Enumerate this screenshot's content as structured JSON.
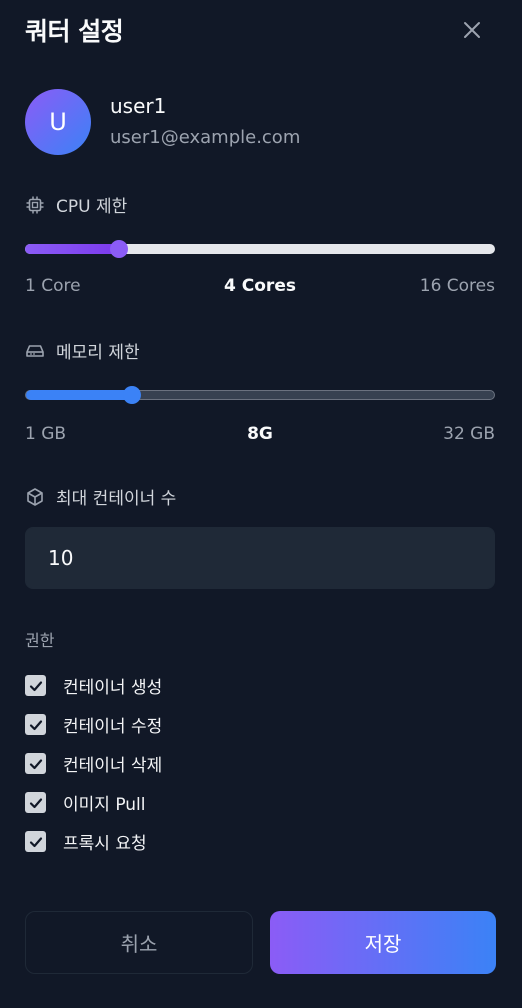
{
  "header": {
    "title": "쿼터 설정",
    "close_icon": "close-icon"
  },
  "user": {
    "avatar_initial": "U",
    "name": "user1",
    "email": "user1@example.com"
  },
  "cpu": {
    "label": "CPU 제한",
    "icon": "cpu-chip-icon",
    "min_label": "1 Core",
    "current_label": "4 Cores",
    "max_label": "16 Cores",
    "value": 4,
    "min": 1,
    "max": 16,
    "color": "#8b5cf6"
  },
  "memory": {
    "label": "메모리 제한",
    "icon": "hard-drive-icon",
    "min_label": "1 GB",
    "current_label": "8G",
    "max_label": "32 GB",
    "value": 8,
    "min": 1,
    "max": 32,
    "color": "#3b82f6"
  },
  "containers": {
    "label": "최대 컨테이너 수",
    "icon": "cube-icon",
    "value": "10"
  },
  "permissions": {
    "heading": "권한",
    "items": [
      {
        "label": "컨테이너 생성",
        "checked": true
      },
      {
        "label": "컨테이너 수정",
        "checked": true
      },
      {
        "label": "컨테이너 삭제",
        "checked": true
      },
      {
        "label": "이미지 Pull",
        "checked": true
      },
      {
        "label": "프록시 요청",
        "checked": true
      }
    ]
  },
  "footer": {
    "cancel_label": "취소",
    "save_label": "저장"
  }
}
